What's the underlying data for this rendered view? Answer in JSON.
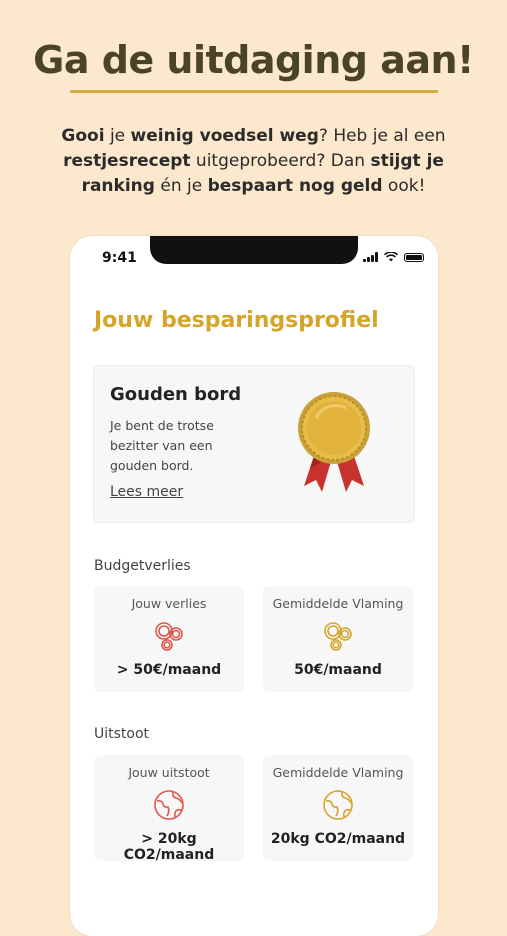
{
  "headline": "Ga de uitdaging aan!",
  "intro": {
    "parts": [
      {
        "text": "Gooi",
        "bold": true
      },
      {
        "text": " je ",
        "bold": false
      },
      {
        "text": "weinig voedsel weg",
        "bold": true
      },
      {
        "text": "? Heb je al een ",
        "bold": false
      },
      {
        "text": "restjesrecept",
        "bold": true
      },
      {
        "text": " uitgeprobeerd? Dan ",
        "bold": false
      },
      {
        "text": "stijgt je ranking",
        "bold": true
      },
      {
        "text": " én je ",
        "bold": false
      },
      {
        "text": "bespaart nog geld",
        "bold": true
      },
      {
        "text": " ook!",
        "bold": false
      }
    ]
  },
  "status_bar": {
    "time": "9:41"
  },
  "profile": {
    "title": "Jouw besparingsprofiel",
    "award": {
      "title": "Gouden bord",
      "description": "Je bent de trotse bezitter van een gouden bord.",
      "link": "Lees meer",
      "icon": "gold-medal-icon"
    }
  },
  "budget": {
    "label": "Budgetverlies",
    "yours": {
      "label": "Jouw verlies",
      "value": "> 50€/maand",
      "icon": "coins-icon",
      "color": "#e0574a"
    },
    "average": {
      "label": "Gemiddelde Vlaming",
      "value": "50€/maand",
      "icon": "coins-icon",
      "color": "#d4a52a"
    }
  },
  "emission": {
    "label": "Uitstoot",
    "yours": {
      "label": "Jouw uitstoot",
      "value": "> 20kg CO2/maand",
      "icon": "globe-icon",
      "color": "#e0574a"
    },
    "average": {
      "label": "Gemiddelde Vlaming",
      "value": "20kg CO2/maand",
      "icon": "globe-icon",
      "color": "#d4a52a"
    }
  },
  "colors": {
    "background": "#fbe8cd",
    "accent_gold": "#d4a52a",
    "accent_red": "#e0574a",
    "headline": "#4a4326"
  }
}
